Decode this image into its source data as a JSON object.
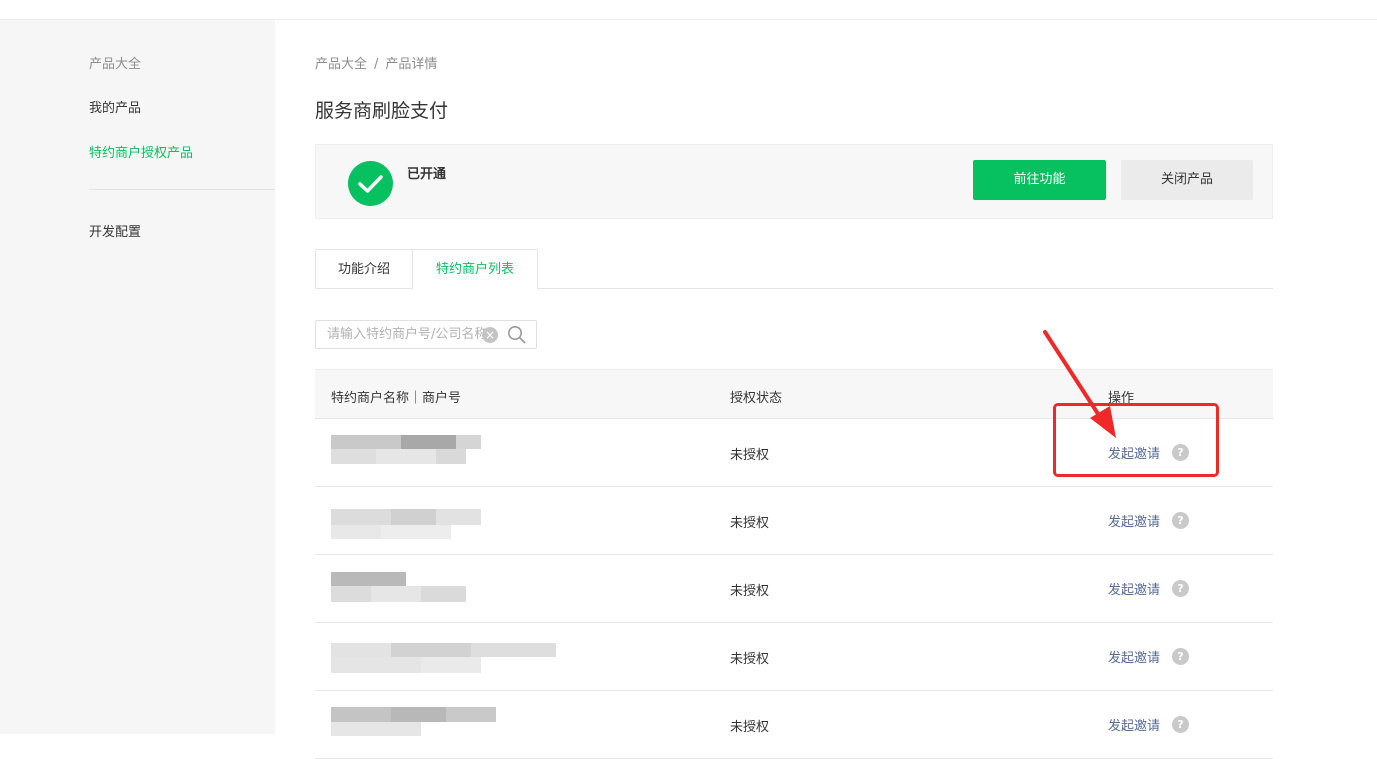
{
  "sidebar": {
    "items": [
      {
        "label": "产品大全"
      },
      {
        "label": "我的产品"
      },
      {
        "label": "特约商户授权产品"
      },
      {
        "label": "开发配置"
      }
    ]
  },
  "breadcrumb": {
    "items": [
      "产品大全",
      "产品详情"
    ],
    "separator": "/"
  },
  "page": {
    "title": "服务商刷脸支付"
  },
  "status": {
    "text": "已开通",
    "primary_button": "前往功能",
    "secondary_button": "关闭产品"
  },
  "tabs": [
    {
      "label": "功能介绍",
      "active": false
    },
    {
      "label": "特约商户列表",
      "active": true
    }
  ],
  "search": {
    "placeholder": "请输入特约商户号/公司名称",
    "value": ""
  },
  "table": {
    "headers": {
      "name": "特约商户名称｜商户号",
      "status": "授权状态",
      "action": "操作"
    },
    "rows": [
      {
        "status": "未授权",
        "action": "发起邀请"
      },
      {
        "status": "未授权",
        "action": "发起邀请"
      },
      {
        "status": "未授权",
        "action": "发起邀请"
      },
      {
        "status": "未授权",
        "action": "发起邀请"
      },
      {
        "status": "未授权",
        "action": "发起邀请"
      }
    ]
  },
  "icons": {
    "check": "check-icon",
    "search": "search-icon",
    "clear": "clear-icon",
    "help": "help-icon",
    "help_glyph": "?",
    "clear_glyph": "×"
  },
  "colors": {
    "brand_green": "#07c160",
    "link_blue": "#576b95",
    "annotation_red": "#ef2828"
  }
}
